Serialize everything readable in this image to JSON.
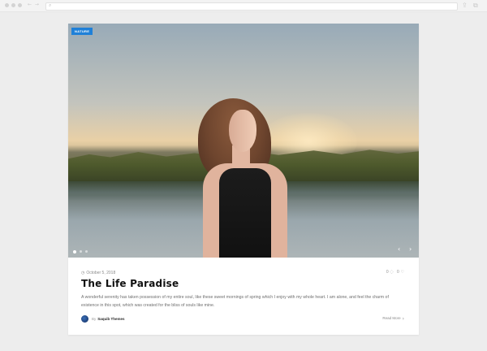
{
  "browser": {
    "back_glyph": "← →",
    "search_glyph": "⌕",
    "share_glyph": "⇪",
    "tabs_glyph": "⧉"
  },
  "post": {
    "category": "NATURE",
    "date": "October 5, 2018",
    "date_glyph": "◷",
    "likes": "0 ♡",
    "comments": "0 ◌",
    "title": "The Life Paradise",
    "excerpt": "A wonderful serenity has taken possession of my entire soul, like these sweet mornings of spring which I enjoy with my whole heart. I am alone, and feel the charm of existence in this spot, which was created for the bliss of souls like mine.",
    "author_prefix": "By",
    "author_name": "Saquib Themes",
    "read_more": "Read More",
    "read_more_chevron": "›"
  },
  "slider": {
    "prev_glyph": "‹",
    "next_glyph": "›",
    "dots": 3,
    "active_dot": 1
  },
  "colors": {
    "badge": "#1f80d8",
    "background": "#ededed",
    "title": "#111111"
  }
}
